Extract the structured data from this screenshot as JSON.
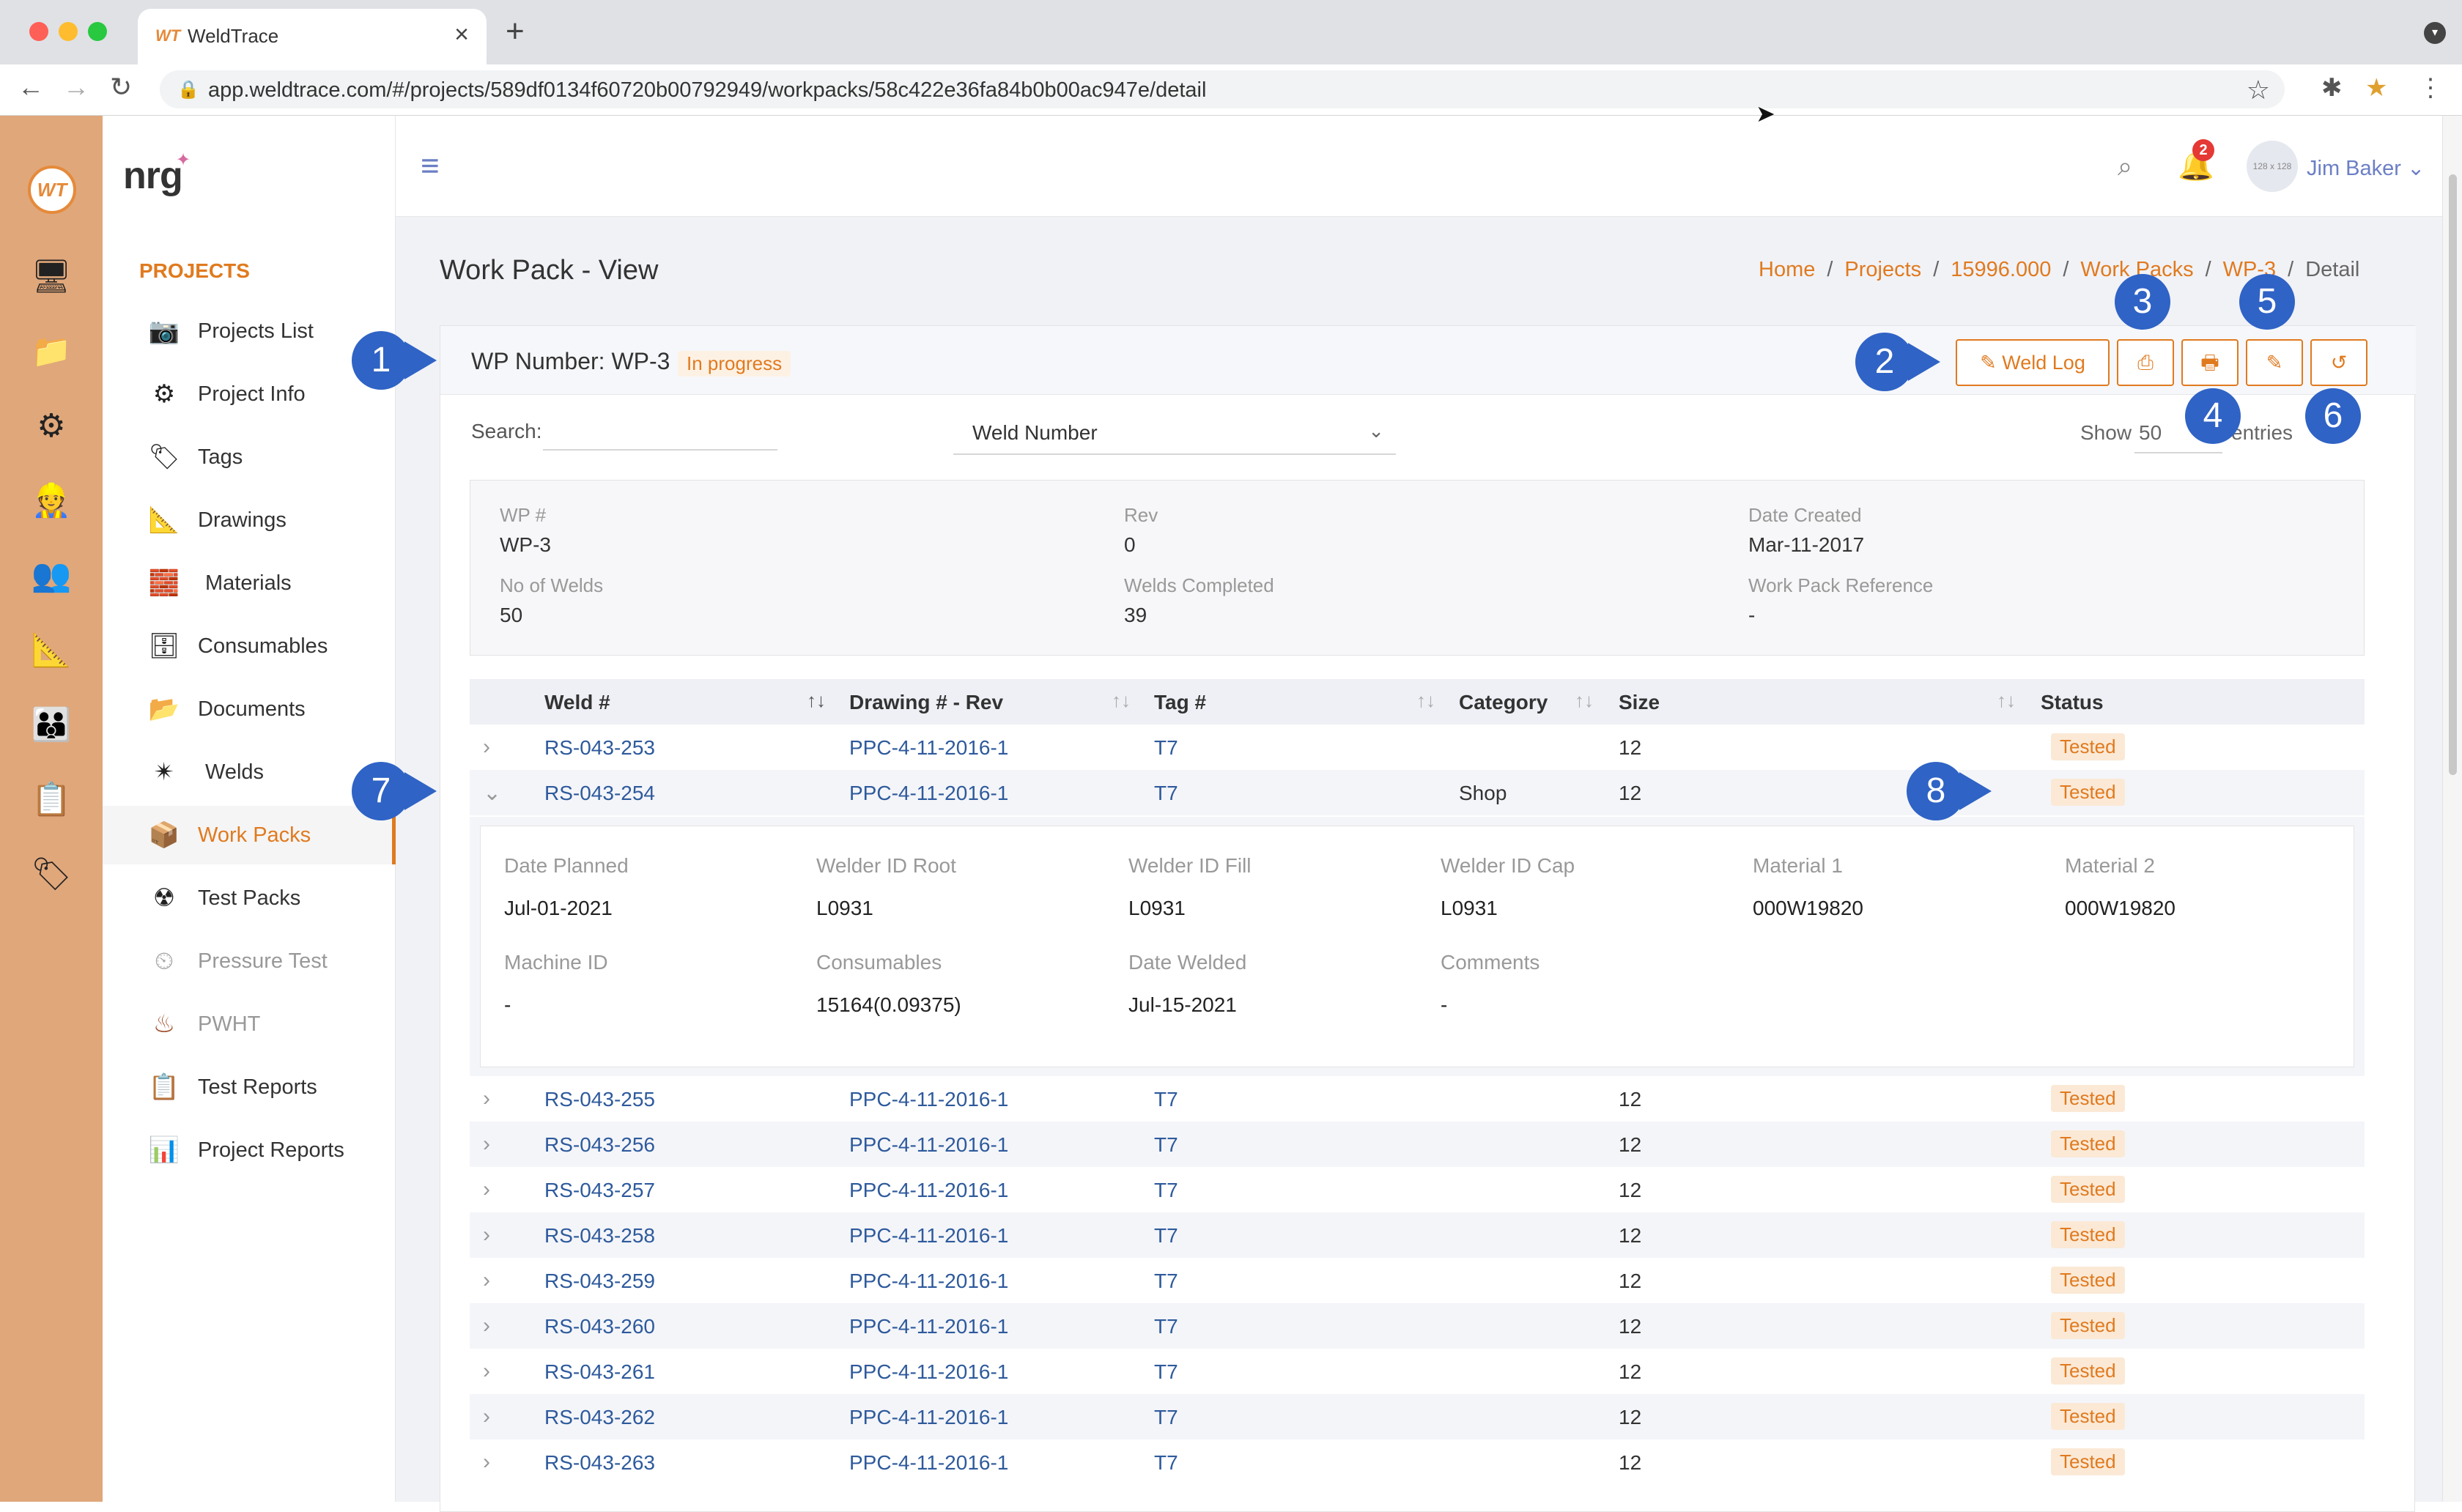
{
  "browser": {
    "tab_title": "WeldTrace",
    "tab_favicon": "WT",
    "url": "app.weldtrace.com/#/projects/589df0134f60720b00792949/workpacks/58c422e36fa84b0b00ac947e/detail"
  },
  "sidebar": {
    "brand": "nrg",
    "section_title": "PROJECTS",
    "items": [
      {
        "label": "Projects List",
        "icon": "folder-camera-icon"
      },
      {
        "label": "Project Info",
        "icon": "gears-icon"
      },
      {
        "label": "Tags",
        "icon": "tag-icon"
      },
      {
        "label": "Drawings",
        "icon": "drawing-tools-icon"
      },
      {
        "label": "Materials",
        "icon": "materials-icon"
      },
      {
        "label": "Consumables",
        "icon": "consumables-icon"
      },
      {
        "label": "Documents",
        "icon": "documents-folder-icon"
      },
      {
        "label": "Welds",
        "icon": "weld-spark-icon"
      },
      {
        "label": "Work Packs",
        "icon": "work-packs-icon"
      },
      {
        "label": "Test Packs",
        "icon": "radiation-icon"
      },
      {
        "label": "Pressure Test",
        "icon": "pressure-gauge-icon"
      },
      {
        "label": "PWHT",
        "icon": "heater-icon"
      },
      {
        "label": "Test Reports",
        "icon": "clipboard-icon"
      },
      {
        "label": "Project Reports",
        "icon": "report-chart-icon"
      }
    ]
  },
  "topbar": {
    "notification_count": "2",
    "avatar_text": "128 x 128",
    "user_name": "Jim Baker ⌄"
  },
  "page": {
    "title": "Work Pack - View",
    "breadcrumb": [
      "Home",
      "Projects",
      "15996.000",
      "Work Packs",
      "WP-3",
      "Detail"
    ]
  },
  "card": {
    "wp_number": "WP Number: WP-3",
    "status": "In progress",
    "weld_log_label": "✎  Weld Log"
  },
  "filters": {
    "search_label": "Search:",
    "search_value": "",
    "select_value": "Weld Number",
    "show_label": "Show",
    "show_value": "50",
    "entries_label": "entries"
  },
  "info": {
    "wp_label": "WP #",
    "wp_value": "WP-3",
    "rev_label": "Rev",
    "rev_value": "0",
    "date_label": "Date Created",
    "date_value": "Mar-11-2017",
    "welds_label": "No of Welds",
    "welds_value": "50",
    "completed_label": "Welds Completed",
    "completed_value": "39",
    "ref_label": "Work Pack Reference",
    "ref_value": "-"
  },
  "table": {
    "headers": [
      "Weld #",
      "Drawing # - Rev",
      "Tag #",
      "Category",
      "Size",
      "Status"
    ],
    "rows": [
      {
        "weld": "RS-043-253",
        "drawing": "PPC-4-11-2016-1",
        "tag": "T7",
        "category": "",
        "size": "12",
        "status": "Tested"
      },
      {
        "weld": "RS-043-254",
        "drawing": "PPC-4-11-2016-1",
        "tag": "T7",
        "category": "Shop",
        "size": "12",
        "status": "Tested"
      },
      {
        "weld": "RS-043-255",
        "drawing": "PPC-4-11-2016-1",
        "tag": "T7",
        "category": "",
        "size": "12",
        "status": "Tested"
      },
      {
        "weld": "RS-043-256",
        "drawing": "PPC-4-11-2016-1",
        "tag": "T7",
        "category": "",
        "size": "12",
        "status": "Tested"
      },
      {
        "weld": "RS-043-257",
        "drawing": "PPC-4-11-2016-1",
        "tag": "T7",
        "category": "",
        "size": "12",
        "status": "Tested"
      },
      {
        "weld": "RS-043-258",
        "drawing": "PPC-4-11-2016-1",
        "tag": "T7",
        "category": "",
        "size": "12",
        "status": "Tested"
      },
      {
        "weld": "RS-043-259",
        "drawing": "PPC-4-11-2016-1",
        "tag": "T7",
        "category": "",
        "size": "12",
        "status": "Tested"
      },
      {
        "weld": "RS-043-260",
        "drawing": "PPC-4-11-2016-1",
        "tag": "T7",
        "category": "",
        "size": "12",
        "status": "Tested"
      },
      {
        "weld": "RS-043-261",
        "drawing": "PPC-4-11-2016-1",
        "tag": "T7",
        "category": "",
        "size": "12",
        "status": "Tested"
      },
      {
        "weld": "RS-043-262",
        "drawing": "PPC-4-11-2016-1",
        "tag": "T7",
        "category": "",
        "size": "12",
        "status": "Tested"
      },
      {
        "weld": "RS-043-263",
        "drawing": "PPC-4-11-2016-1",
        "tag": "T7",
        "category": "",
        "size": "12",
        "status": "Tested"
      }
    ],
    "expanded_detail": {
      "date_planned_label": "Date Planned",
      "date_planned": "Jul-01-2021",
      "welder_root_label": "Welder ID Root",
      "welder_root": "L0931",
      "welder_fill_label": "Welder ID Fill",
      "welder_fill": "L0931",
      "welder_cap_label": "Welder ID Cap",
      "welder_cap": "L0931",
      "material1_label": "Material 1",
      "material1": "000W19820",
      "material2_label": "Material 2",
      "material2": "000W19820",
      "machine_label": "Machine ID",
      "machine": "-",
      "consumables_label": "Consumables",
      "consumables": "15164(0.09375)",
      "date_welded_label": "Date Welded",
      "date_welded": "Jul-15-2021",
      "comments_label": "Comments",
      "comments": "-"
    }
  },
  "callouts": [
    "1",
    "2",
    "3",
    "4",
    "5",
    "6",
    "7",
    "8"
  ],
  "colors": {
    "accent": "#e07a1f",
    "link": "#2e5a9c",
    "callout": "#2f63c5",
    "rail": "#e0a77a"
  }
}
